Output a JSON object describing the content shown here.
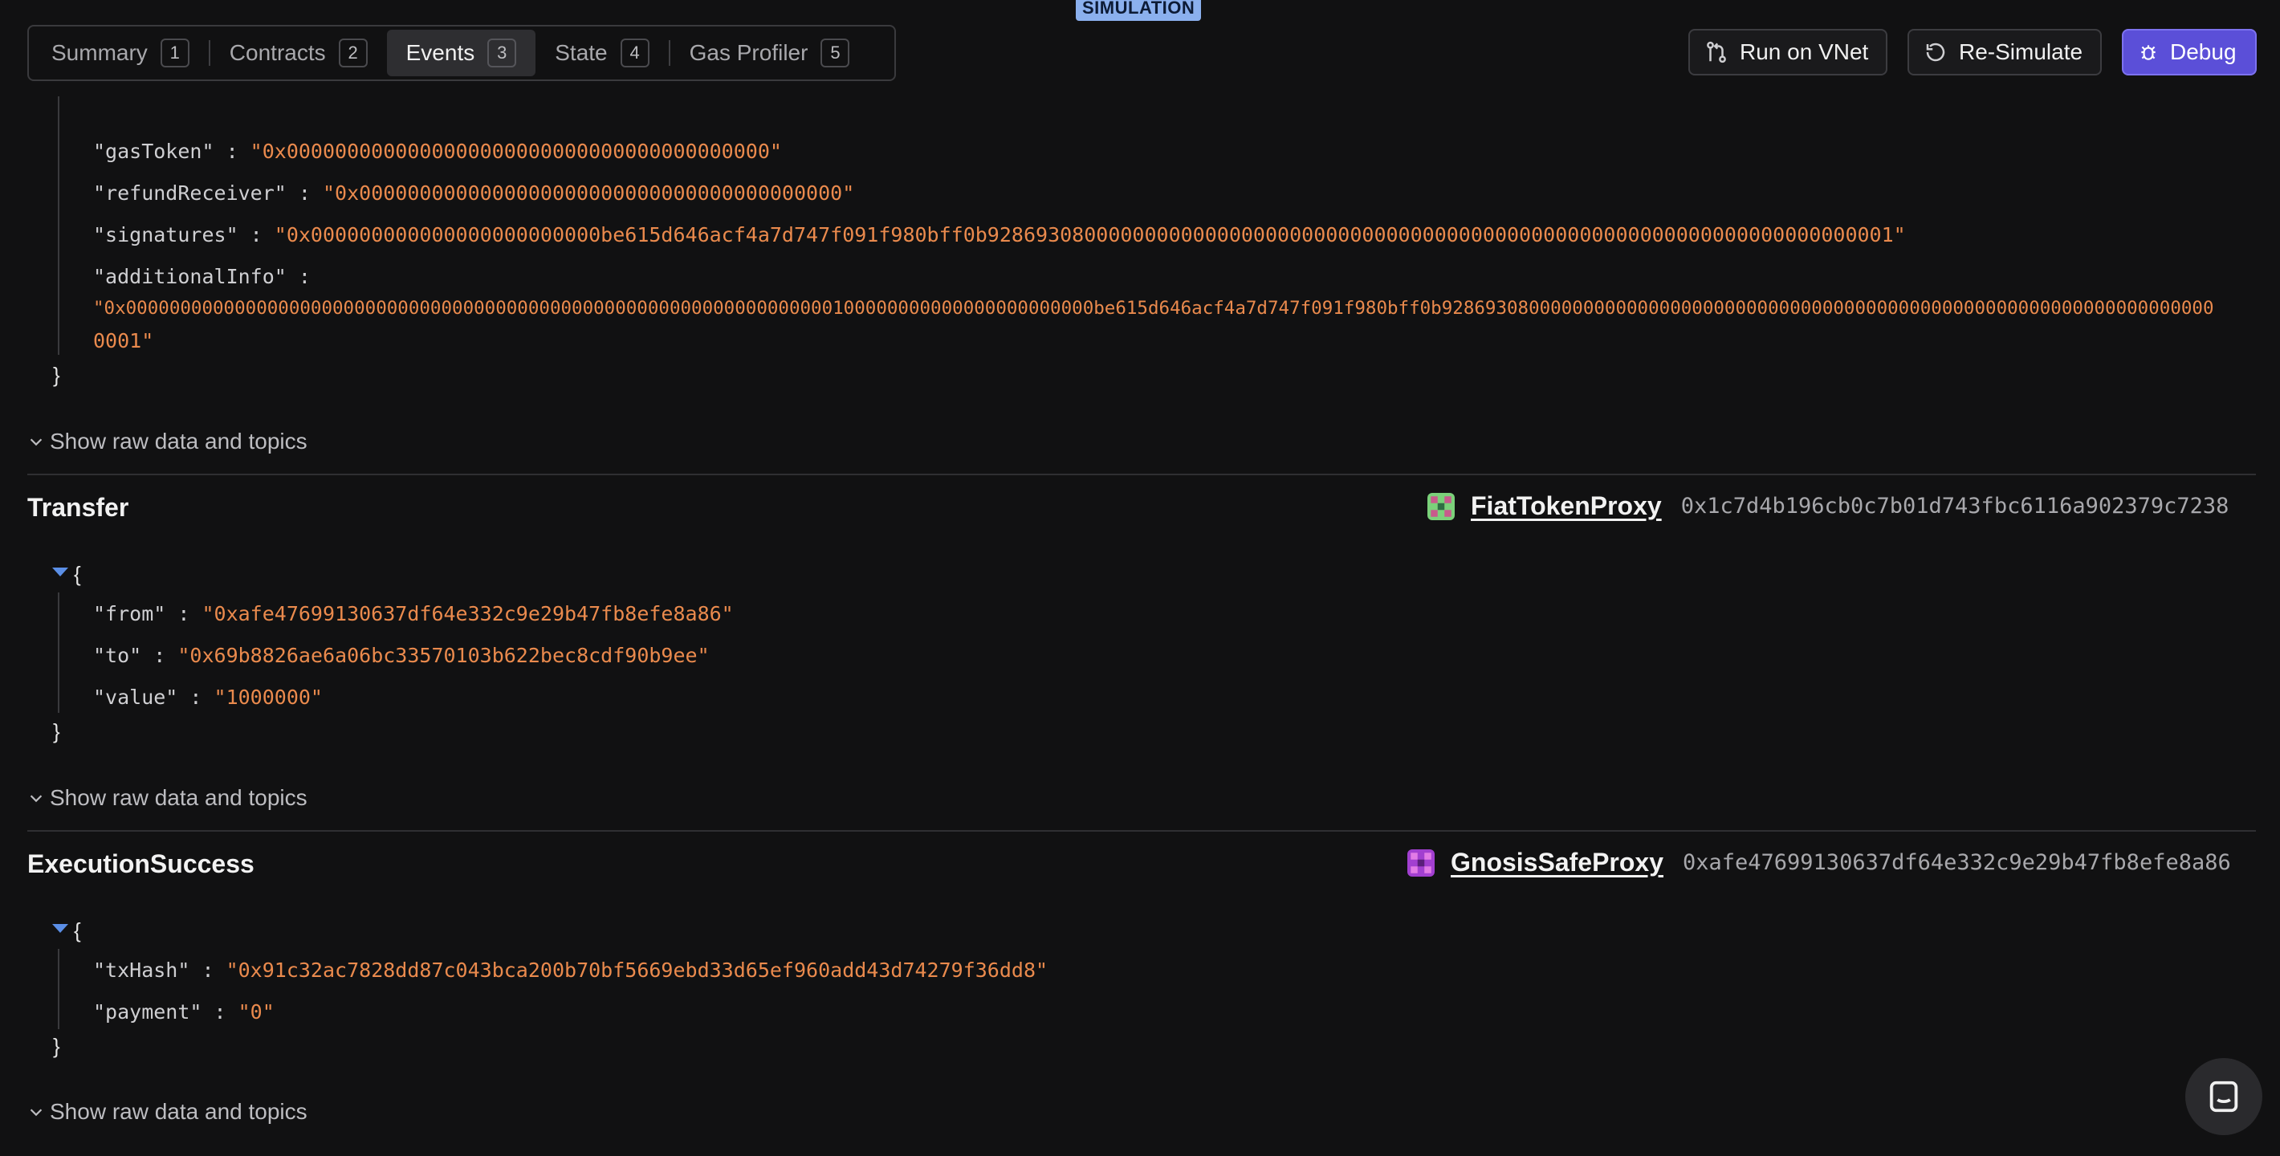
{
  "badge": "SIMULATION",
  "tabs": [
    {
      "label": "Summary",
      "num": "1"
    },
    {
      "label": "Contracts",
      "num": "2"
    },
    {
      "label": "Events",
      "num": "3"
    },
    {
      "label": "State",
      "num": "4"
    },
    {
      "label": "Gas Profiler",
      "num": "5"
    }
  ],
  "actions": {
    "run_vnet": "Run on VNet",
    "resimulate": "Re-Simulate",
    "debug": "Debug"
  },
  "show_raw": "Show raw data and topics",
  "event0": {
    "fields": [
      {
        "key": "\"gasToken\"",
        "value": "\"0x0000000000000000000000000000000000000000\""
      },
      {
        "key": "\"refundReceiver\"",
        "value": "\"0x0000000000000000000000000000000000000000\""
      },
      {
        "key": "\"signatures\"",
        "value": "\"0x000000000000000000000000be615d646acf4a7d747f091f980bff0b928693080000000000000000000000000000000000000000000000000000000000000000001\""
      },
      {
        "key": "\"additionalInfo\"",
        "value_line1": "\"0x00000000000000000000000000000000000000000000000000000000000000000100000000000000000000000be615d646acf4a7d747f091f980bff0b92869308000000000000000000000000000000000000000000000000000000000000000",
        "value_line2": "0001\""
      }
    ]
  },
  "event1": {
    "name": "Transfer",
    "contract": "FiatTokenProxy",
    "address": "0x1c7d4b196cb0c7b01d743fbc6116a902379c7238",
    "fields": [
      {
        "key": "\"from\"",
        "value": "\"0xafe47699130637df64e332c9e29b47fb8efe8a86\""
      },
      {
        "key": "\"to\"",
        "value": "\"0x69b8826ae6a06bc33570103b622bec8cdf90b9ee\""
      },
      {
        "key": "\"value\"",
        "value": "\"1000000\""
      }
    ]
  },
  "event2": {
    "name": "ExecutionSuccess",
    "contract": "GnosisSafeProxy",
    "address": "0xafe47699130637df64e332c9e29b47fb8efe8a86",
    "fields": [
      {
        "key": "\"txHash\"",
        "value": "\"0x91c32ac7828dd87c043bca200b70bf5669ebd33d65ef960add43d74279f36dd8\""
      },
      {
        "key": "\"payment\"",
        "value": "\"0\""
      }
    ]
  },
  "punct": {
    "open": "{",
    "close": "}",
    "colon": " : "
  },
  "colors": {
    "accent": "#5b4fd8",
    "string": "#ea8a4d",
    "badge": "#8bb0ee"
  }
}
